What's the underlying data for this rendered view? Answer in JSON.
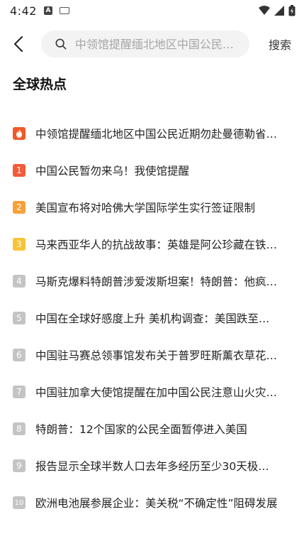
{
  "status_bar": {
    "time": "4:42",
    "icons": [
      "notification-a-icon",
      "keyboard-icon",
      "wifi-icon",
      "signal-icon",
      "battery-charging-icon"
    ]
  },
  "header": {
    "search_placeholder": "中领馆提醒缅北地区中国公民…",
    "search_button": "搜索"
  },
  "section": {
    "title": "全球热点"
  },
  "colors": {
    "rank_top": "#f05a28",
    "rank_1": "#f25b3c",
    "rank_2": "#f7a13a",
    "rank_3": "#f8c336",
    "rank_other": "#c4c4c4"
  },
  "hot_list": [
    {
      "rank": "",
      "text": "中领馆提醒缅北地区中国公民近期勿赴曼德勒省…"
    },
    {
      "rank": "1",
      "text": "中国公民暂勿来乌！我使馆提醒"
    },
    {
      "rank": "2",
      "text": "美国宣布将对哈佛大学国际学生实行签证限制"
    },
    {
      "rank": "3",
      "text": "马来西亚华人的抗战故事：英雄是阿公珍藏在铁…"
    },
    {
      "rank": "4",
      "text": "马斯克爆料特朗普涉爱泼斯坦案！特朗普：他疯…"
    },
    {
      "rank": "5",
      "text": "中国在全球好感度上升 美机构调查：美国跌至…"
    },
    {
      "rank": "6",
      "text": "中国驻马赛总领事馆发布关于普罗旺斯薰衣草花…"
    },
    {
      "rank": "7",
      "text": "中国驻加拿大使馆提醒在加中国公民注意山火灾…"
    },
    {
      "rank": "8",
      "text": "特朗普：12个国家的公民全面暂停进入美国"
    },
    {
      "rank": "9",
      "text": "报告显示全球半数人口去年多经历至少30天极…"
    },
    {
      "rank": "10",
      "text": "欧洲电池展参展企业：美关税“不确定性”阻碍发展"
    }
  ]
}
